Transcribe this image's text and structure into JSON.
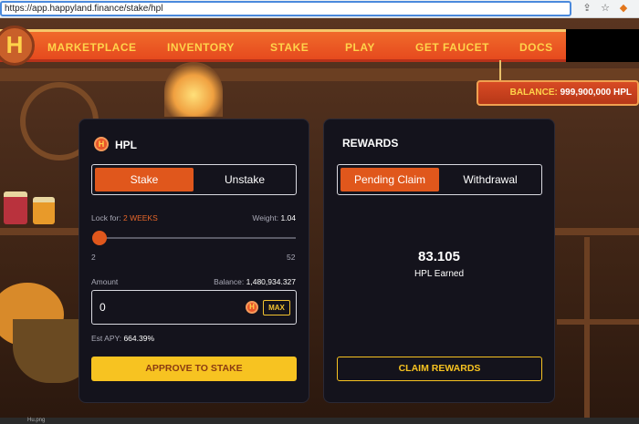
{
  "browser": {
    "url": "https://app.happyland.finance/stake/hpl"
  },
  "nav": {
    "logo_letter": "H",
    "items": [
      "MARKETPLACE",
      "INVENTORY",
      "STAKE",
      "PLAY",
      "GET FAUCET",
      "DOCS"
    ]
  },
  "balance": {
    "label": "BALANCE:",
    "value": "999,900,000 HPL"
  },
  "stake_card": {
    "token_symbol": "HPL",
    "tabs": [
      "Stake",
      "Unstake"
    ],
    "active_tab": "Stake",
    "lock_label": "Lock for:",
    "lock_value": "2 WEEKS",
    "weight_label": "Weight:",
    "weight_value": "1.04",
    "slider": {
      "min": "2",
      "max": "52",
      "current": 2
    },
    "amount_label": "Amount",
    "balance_label": "Balance:",
    "balance_value": "1,480,934.327",
    "amount_value": "0",
    "max_label": "MAX",
    "apy_label": "Est APY:",
    "apy_value": "664.39%",
    "approve_label": "APPROVE TO STAKE"
  },
  "rewards_card": {
    "title": "REWARDS",
    "tabs": [
      "Pending Claim",
      "Withdrawal"
    ],
    "active_tab": "Pending Claim",
    "earned_amount": "83.105",
    "earned_label": "HPL Earned",
    "claim_label": "CLAIM REWARDS"
  },
  "footer": {
    "file": "Hu.png"
  },
  "colors": {
    "accent_orange": "#e0571c",
    "button_yellow": "#f7c321",
    "card_bg": "#14131c",
    "nav_orange": "#e64a1e"
  }
}
